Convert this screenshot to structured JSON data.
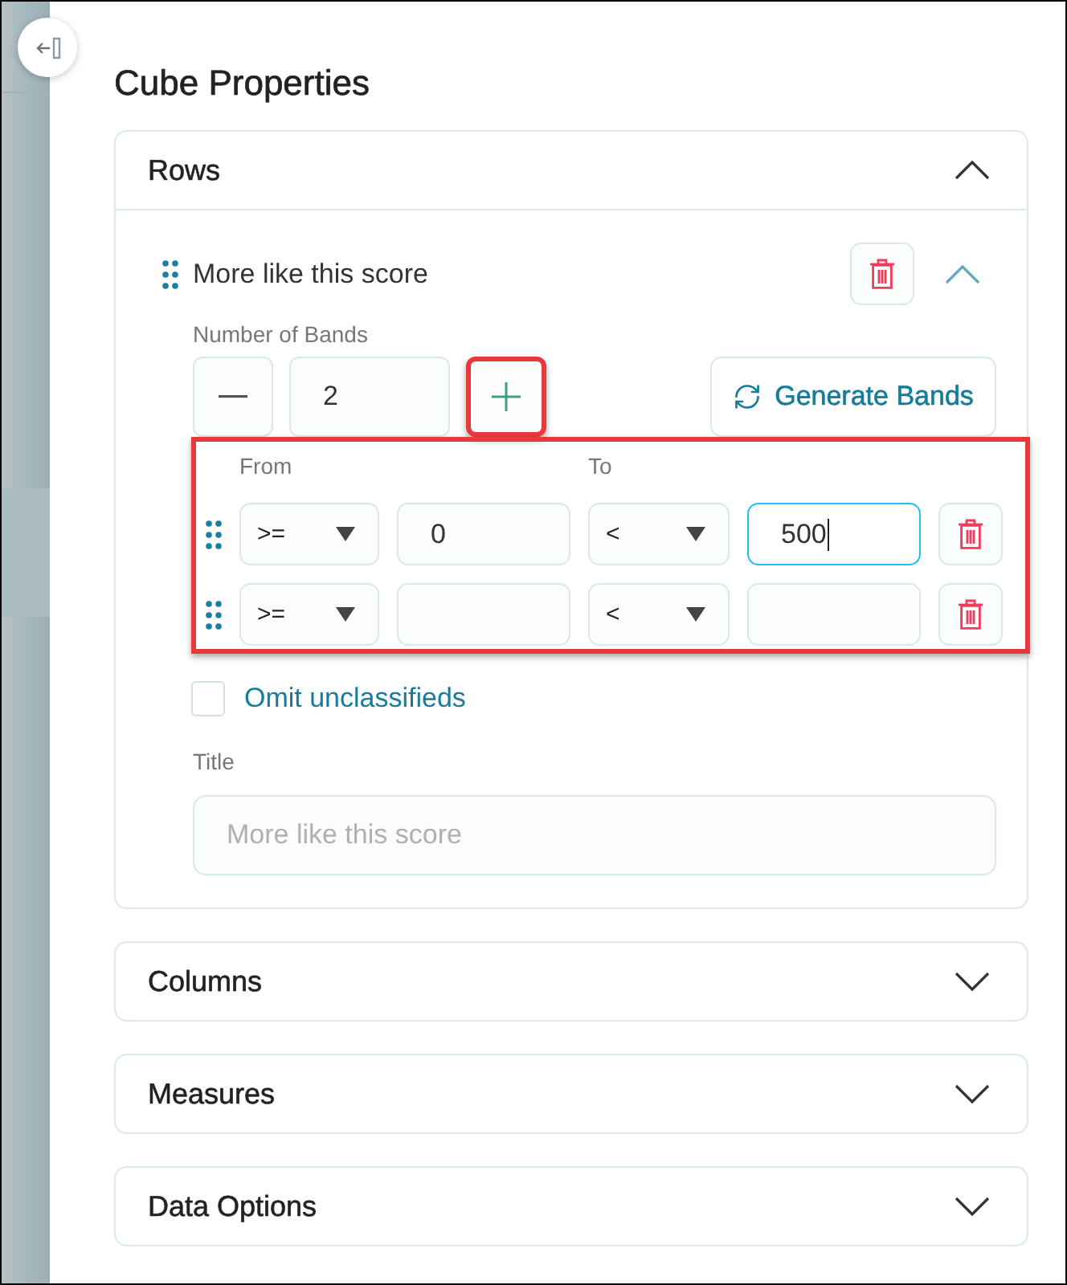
{
  "panel": {
    "title": "Cube Properties"
  },
  "sections": [
    {
      "title": "Rows",
      "expanded": true,
      "items": [
        {
          "name": "More like this score",
          "expanded": true,
          "bands": {
            "label": "Number of Bands",
            "count": "2",
            "plus_highlighted": true,
            "generate_button": "Generate Bands",
            "highlighted": true,
            "from_header": "From",
            "to_header": "To",
            "rows": [
              {
                "from_operator": ">=",
                "from_value": "0",
                "to_operator": "<",
                "to_value": "500",
                "to_focused": true
              },
              {
                "from_operator": ">=",
                "to_operator": "<",
                "to_focused": false
              }
            ]
          },
          "omit_unclassifieds": {
            "label": "Omit unclassifieds",
            "checked": false
          },
          "title_field": {
            "label": "Title",
            "placeholder": "More like this score"
          }
        }
      ]
    },
    {
      "title": "Columns",
      "expanded": false
    },
    {
      "title": "Measures",
      "expanded": false
    },
    {
      "title": "Data Options",
      "expanded": false
    }
  ]
}
